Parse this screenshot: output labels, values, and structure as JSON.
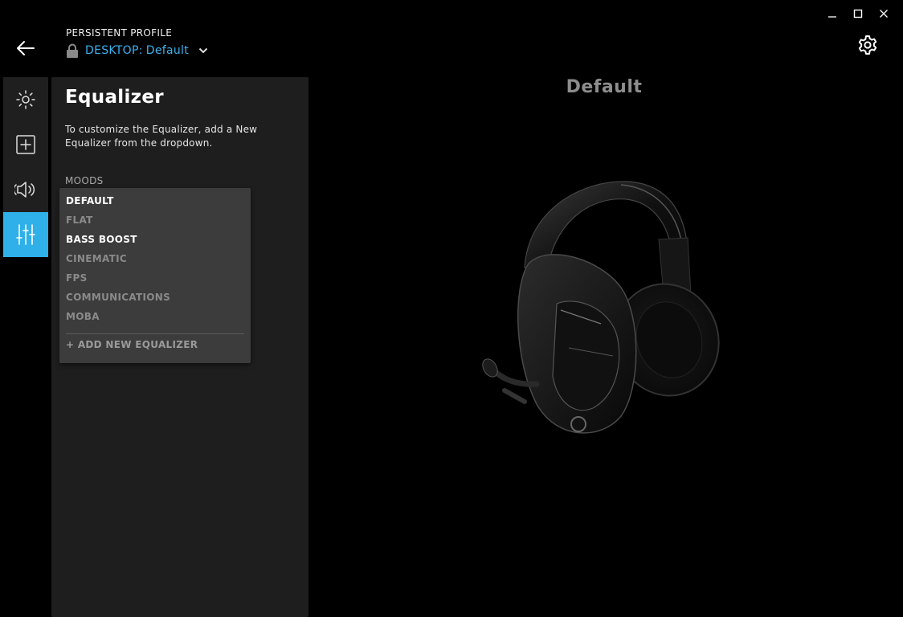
{
  "window": {
    "minimize_icon": "minimize-icon",
    "maximize_icon": "maximize-icon",
    "close_icon": "close-icon"
  },
  "header": {
    "profile_label": "PERSISTENT PROFILE",
    "profile_prefix": "DESKTOP:",
    "profile_name": "Default",
    "accent_color": "#3cb3f0"
  },
  "rail": {
    "items": [
      {
        "icon": "lighting-icon",
        "active": false
      },
      {
        "icon": "assignments-icon",
        "active": false
      },
      {
        "icon": "audio-icon",
        "active": false
      },
      {
        "icon": "equalizer-icon",
        "active": true
      }
    ],
    "active_color": "#2fb0e8"
  },
  "panel": {
    "title": "Equalizer",
    "description": "To customize the Equalizer, add a New Equalizer from the dropdown.",
    "moods_label": "MOODS"
  },
  "dropdown": {
    "items": [
      {
        "label": "DEFAULT",
        "style": "bright"
      },
      {
        "label": "FLAT",
        "style": "dim"
      },
      {
        "label": "BASS BOOST",
        "style": "bright"
      },
      {
        "label": "CINEMATIC",
        "style": "dim"
      },
      {
        "label": "FPS",
        "style": "dim"
      },
      {
        "label": "COMMUNICATIONS",
        "style": "dim"
      },
      {
        "label": "MOBA",
        "style": "dim"
      }
    ],
    "add_label": "+ ADD NEW EQUALIZER"
  },
  "main": {
    "device_title": "Default",
    "device_image": "headset-image"
  }
}
